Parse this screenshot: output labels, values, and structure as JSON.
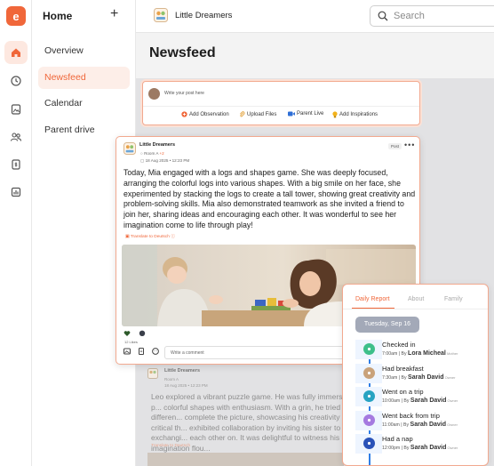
{
  "rail": {
    "logo_text": "e"
  },
  "nav": {
    "title": "Home",
    "items": [
      {
        "label": "Overview"
      },
      {
        "label": "Newsfeed"
      },
      {
        "label": "Calendar"
      },
      {
        "label": "Parent drive"
      }
    ]
  },
  "topbar": {
    "school_name": "Little Dreamers",
    "search_placeholder": "Search"
  },
  "page": {
    "title": "Newsfeed"
  },
  "composer": {
    "placeholder": "Write your post here",
    "actions": [
      {
        "label": "Add Observation"
      },
      {
        "label": "Upload Files"
      },
      {
        "label": "Parent Live"
      },
      {
        "label": "Add Inspirations"
      }
    ]
  },
  "post": {
    "school": "Little Dreamers",
    "room": "Room A",
    "room_more": "+2",
    "date": "18 Aug 2025 • 12:23 PM",
    "tag": "Post",
    "body": "Today, Mia engaged with a logs and shapes game. She was deeply focused, arranging the colorful logs into various shapes. With a big smile on her face, she experimented by stacking the logs to create a tall tower, showing great creativity and problem-solving skills. Mia also demonstrated teamwork as she invited a friend to join her, sharing ideas and encouraging each other. It was wonderful to see her imagination come to life through play!",
    "translate": "Translate to Deutsch",
    "likes": "12 Likes",
    "comment_placeholder": "Write a comment"
  },
  "bg_post": {
    "school": "Little Dreamers",
    "room": "Room A",
    "date": "18 Aug 2025 • 12:23 PM",
    "body": "Leo explored a vibrant puzzle game. He was fully immersed, p... colorful shapes with enthusiasm. With a grin, he tried differen... complete the picture, showcasing his creativity and critical th... exhibited collaboration by inviting his sister to help, exchangi... each other on. It was delightful to witness his imagination flou...",
    "translate": "Translate to Deutsch"
  },
  "report": {
    "tabs": [
      {
        "label": "Daily Report"
      },
      {
        "label": "About"
      },
      {
        "label": "Family"
      }
    ],
    "date": "Tuesday, Sep 16",
    "events": [
      {
        "title": "Checked in",
        "time": "7:00am",
        "by": "By",
        "person": "Lora Micheal",
        "role": "Mother",
        "color": "#3dbf8a"
      },
      {
        "title": "Had breakfast",
        "time": "7:30am",
        "by": "By",
        "person": "Sarah David",
        "role": "Owner",
        "color": "#c9a27a"
      },
      {
        "title": "Went on a trip",
        "time": "10:00am",
        "by": "By",
        "person": "Sarah David",
        "role": "Owner",
        "color": "#27a3c2"
      },
      {
        "title": "Went back from trip",
        "time": "11:00am",
        "by": "By",
        "person": "Sarah David",
        "role": "Owner",
        "color": "#a57ae0"
      },
      {
        "title": "Had a nap",
        "time": "12:00pm",
        "by": "By",
        "person": "Sarah David",
        "role": "Owner",
        "color": "#2a52b8"
      }
    ]
  }
}
